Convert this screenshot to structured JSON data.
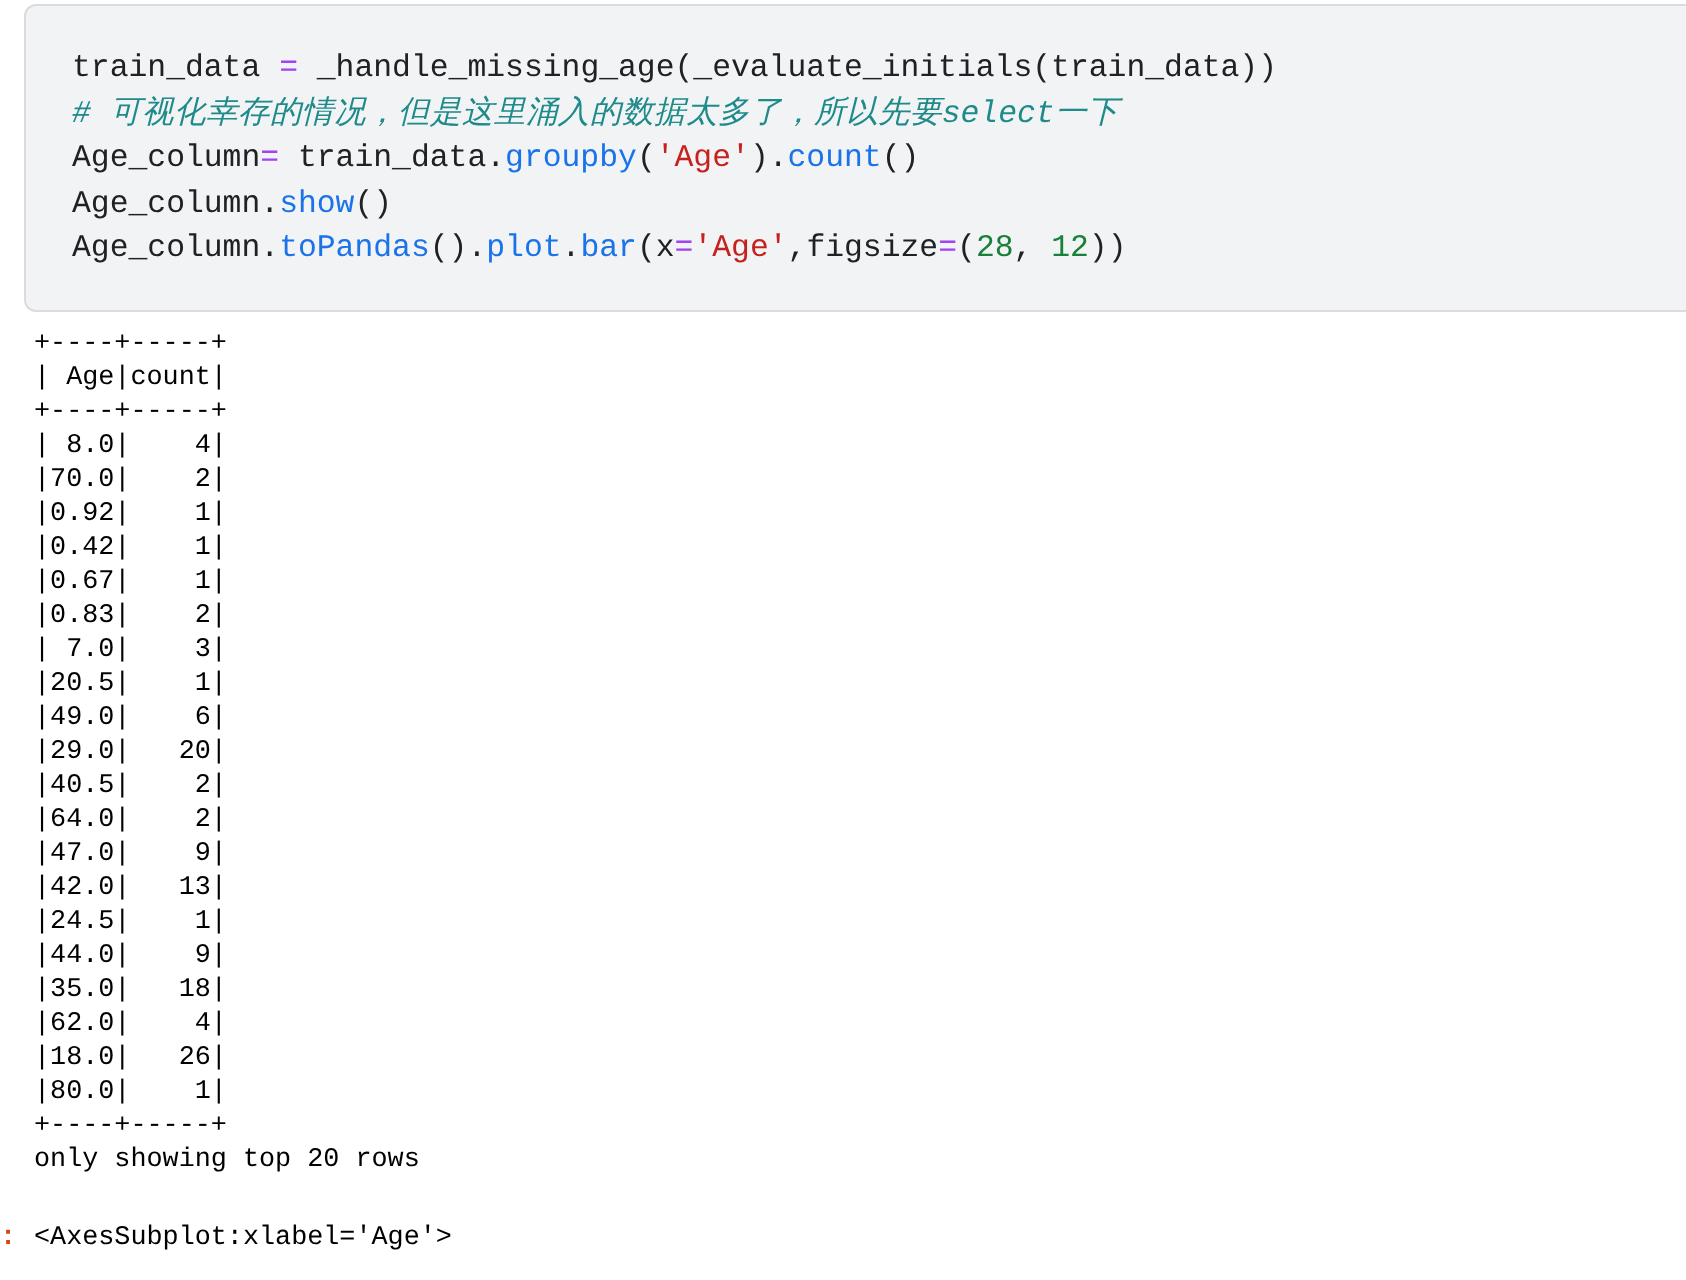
{
  "code_cell": {
    "lines": [
      {
        "tokens": [
          {
            "kind": "plain",
            "text": "train_data "
          },
          {
            "kind": "op",
            "text": "="
          },
          {
            "kind": "plain",
            "text": " _handle_missing_age(_evaluate_initials(train_data))"
          }
        ]
      },
      {
        "tokens": [
          {
            "kind": "comment",
            "text": "# 可视化幸存的情况，但是这里涌入的数据太多了，所以先要select一下"
          }
        ]
      },
      {
        "tokens": [
          {
            "kind": "plain",
            "text": "Age_column"
          },
          {
            "kind": "op",
            "text": "="
          },
          {
            "kind": "plain",
            "text": " train_data."
          },
          {
            "kind": "func",
            "text": "groupby"
          },
          {
            "kind": "plain",
            "text": "("
          },
          {
            "kind": "string",
            "text": "'Age'"
          },
          {
            "kind": "plain",
            "text": ")."
          },
          {
            "kind": "func",
            "text": "count"
          },
          {
            "kind": "plain",
            "text": "()"
          }
        ]
      },
      {
        "tokens": [
          {
            "kind": "plain",
            "text": "Age_column."
          },
          {
            "kind": "func",
            "text": "show"
          },
          {
            "kind": "plain",
            "text": "()"
          }
        ]
      },
      {
        "tokens": [
          {
            "kind": "plain",
            "text": "Age_column."
          },
          {
            "kind": "func",
            "text": "toPandas"
          },
          {
            "kind": "plain",
            "text": "()."
          },
          {
            "kind": "func",
            "text": "plot"
          },
          {
            "kind": "plain",
            "text": "."
          },
          {
            "kind": "func",
            "text": "bar"
          },
          {
            "kind": "plain",
            "text": "(x"
          },
          {
            "kind": "op",
            "text": "="
          },
          {
            "kind": "string",
            "text": "'Age'"
          },
          {
            "kind": "plain",
            "text": ",figsize"
          },
          {
            "kind": "op",
            "text": "="
          },
          {
            "kind": "plain",
            "text": "("
          },
          {
            "kind": "number",
            "text": "28"
          },
          {
            "kind": "plain",
            "text": ", "
          },
          {
            "kind": "number",
            "text": "12"
          },
          {
            "kind": "plain",
            "text": "))"
          }
        ]
      }
    ]
  },
  "output": {
    "lines": [
      "+----+-----+",
      "| Age|count|",
      "+----+-----+",
      "| 8.0|    4|",
      "|70.0|    2|",
      "|0.92|    1|",
      "|0.42|    1|",
      "|0.67|    1|",
      "|0.83|    2|",
      "| 7.0|    3|",
      "|20.5|    1|",
      "|49.0|    6|",
      "|29.0|   20|",
      "|40.5|    2|",
      "|64.0|    2|",
      "|47.0|    9|",
      "|42.0|   13|",
      "|24.5|    1|",
      "|44.0|    9|",
      "|35.0|   18|",
      "|62.0|    4|",
      "|18.0|   26|",
      "|80.0|    1|",
      "+----+-----+",
      "only showing top 20 rows"
    ]
  },
  "result": {
    "prompt": ":",
    "text": "<AxesSubplot:xlabel='Age'>"
  }
}
